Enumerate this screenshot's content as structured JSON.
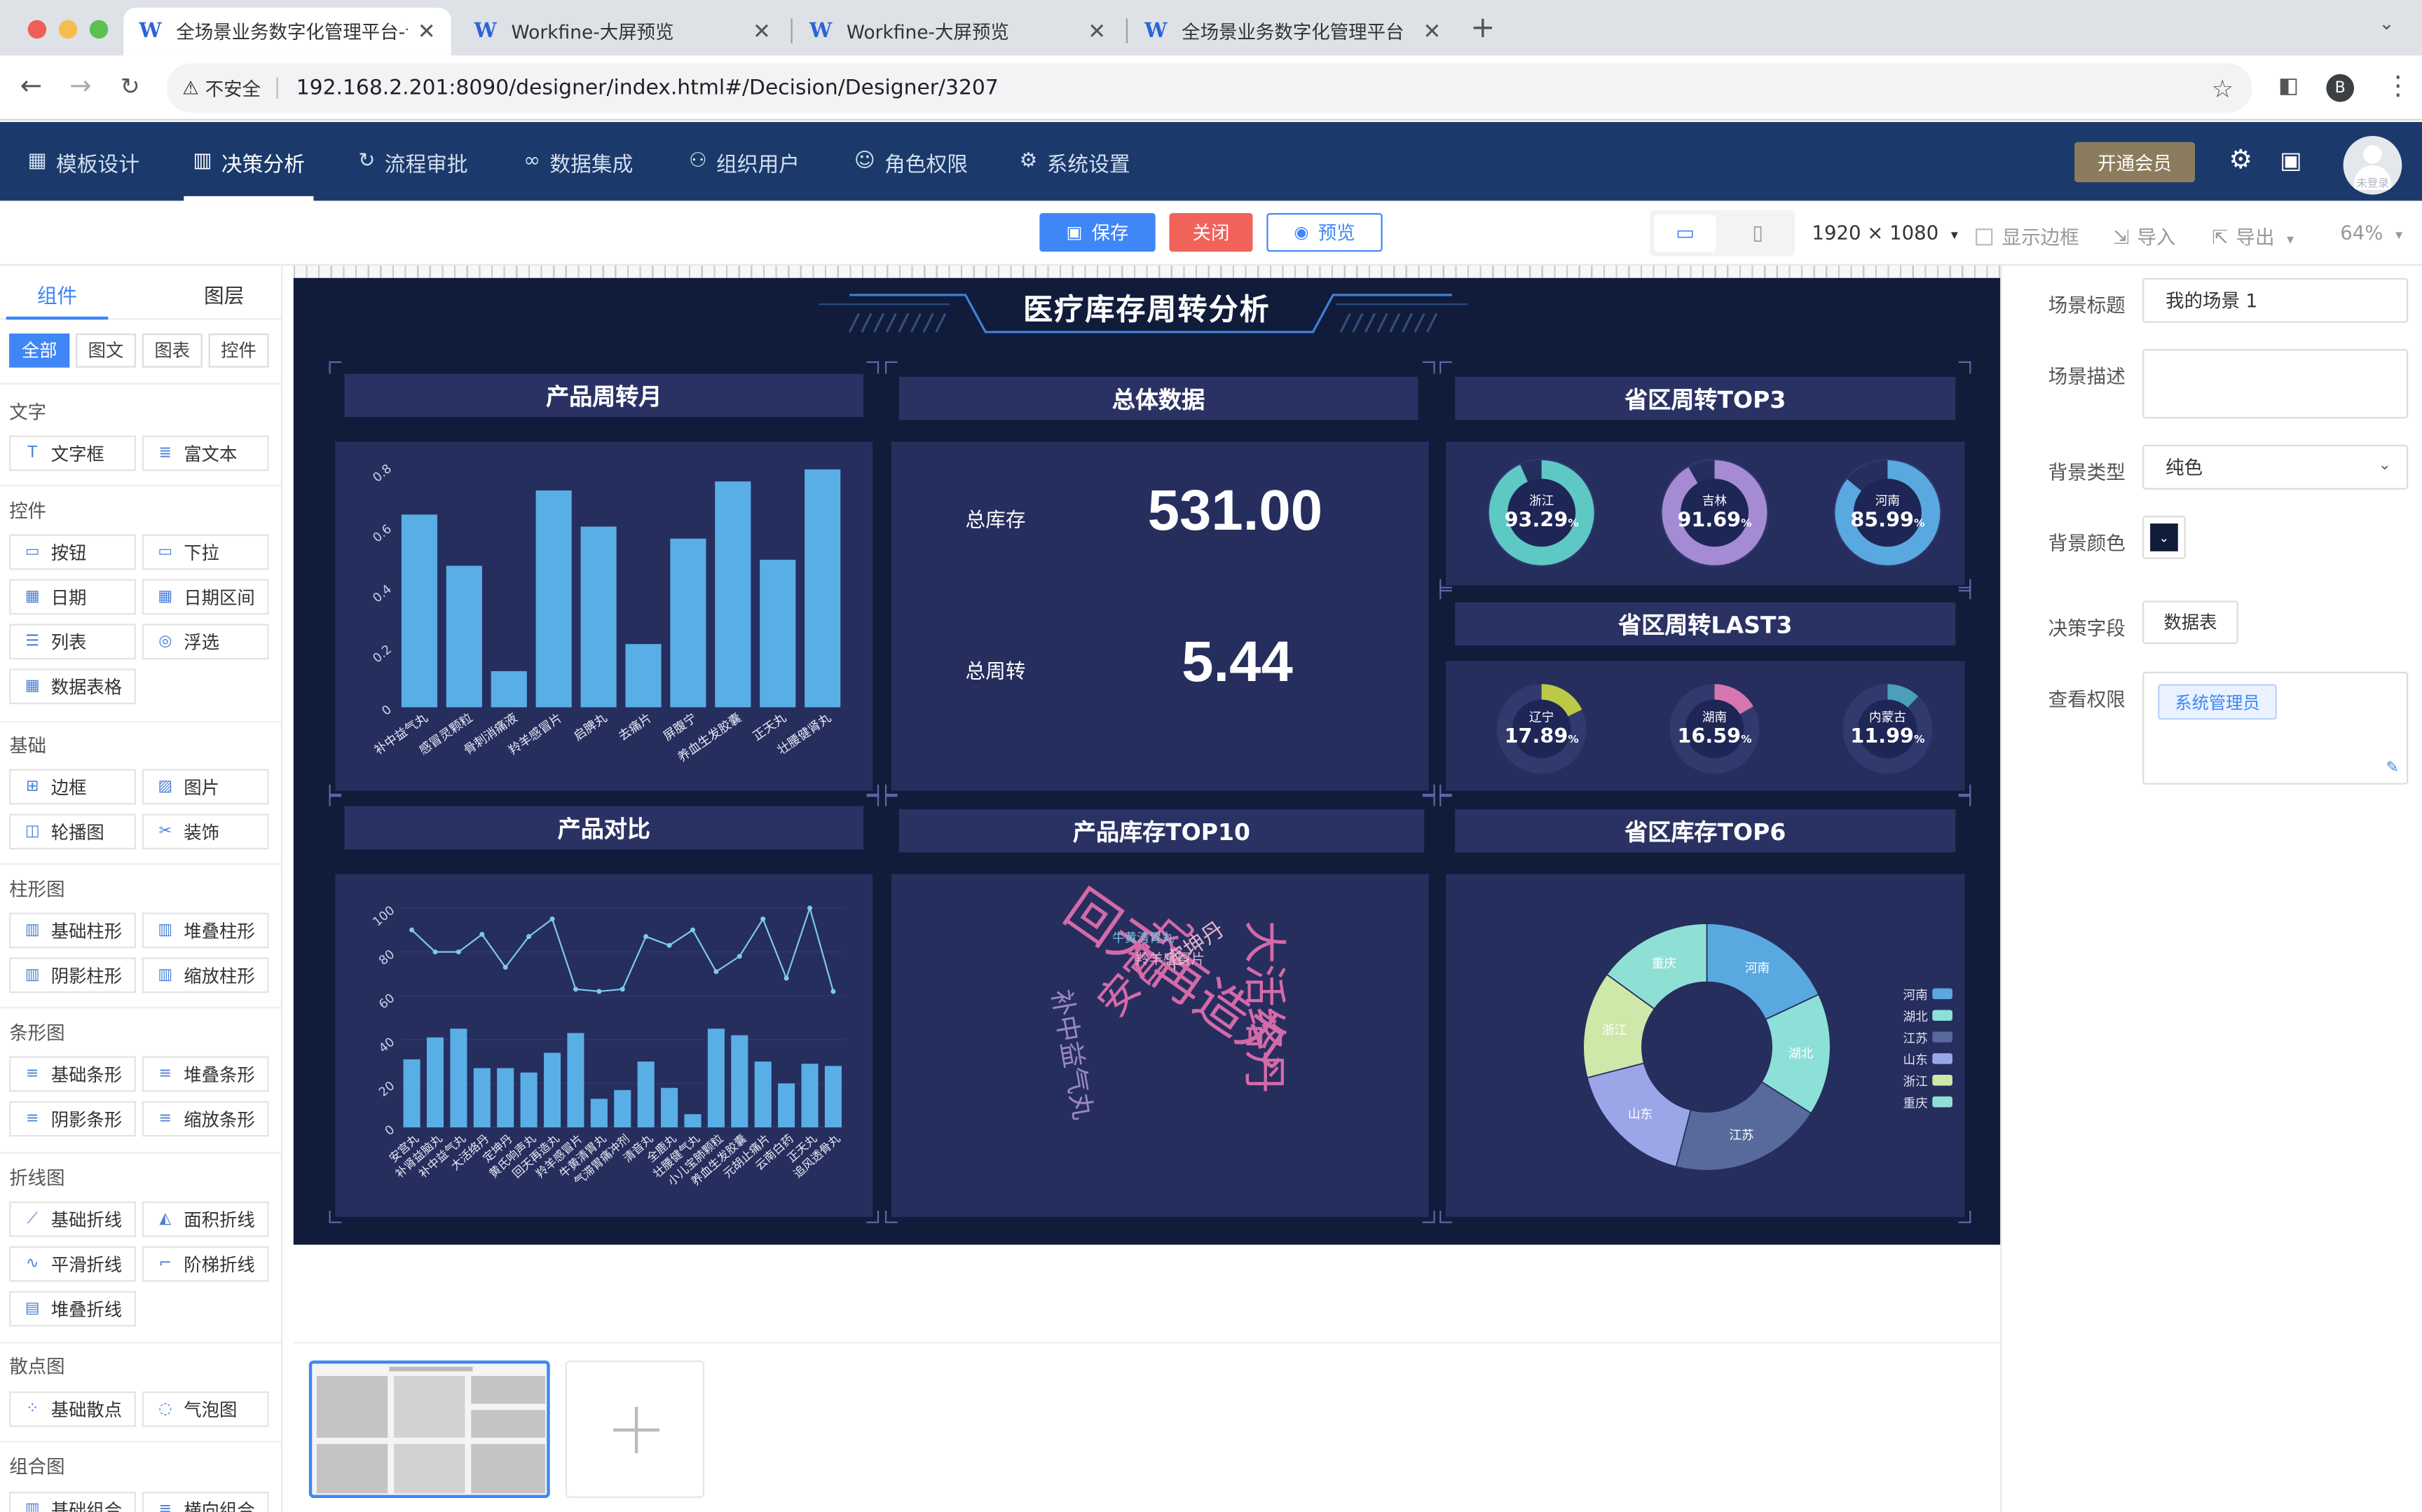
{
  "browser": {
    "tabs": [
      {
        "title": "全场景业务数字化管理平台-设计",
        "active": true
      },
      {
        "title": "Workfine-大屏预览",
        "active": false
      },
      {
        "title": "Workfine-大屏预览",
        "active": false
      },
      {
        "title": "全场景业务数字化管理平台",
        "active": false
      }
    ],
    "security": "不安全",
    "url": "192.168.2.201:8090/designer/index.html#/Decision/Designer/3207",
    "profile": "B"
  },
  "appnav": {
    "items": [
      "模板设计",
      "决策分析",
      "流程审批",
      "数据集成",
      "组织用户",
      "角色权限",
      "系统设置"
    ],
    "vip": "开通会员",
    "avatar_label": "未登录"
  },
  "toolbar": {
    "save": "保存",
    "close": "关闭",
    "preview": "预览",
    "resolution": "1920 × 1080",
    "show_border": "显示边框",
    "import": "导入",
    "export": "导出",
    "zoom": "64%"
  },
  "left": {
    "tabs": [
      "组件",
      "图层"
    ],
    "filters": [
      "全部",
      "图文",
      "图表",
      "控件"
    ],
    "cat_text": "文字",
    "text_items": [
      "文字框",
      "富文本"
    ],
    "cat_control": "控件",
    "control_items": [
      "按钮",
      "下拉",
      "日期",
      "日期区间",
      "列表",
      "浮选",
      "数据表格"
    ],
    "cat_basic": "基础",
    "basic_items": [
      "边框",
      "图片",
      "轮播图",
      "装饰"
    ],
    "cat_column": "柱形图",
    "column_items": [
      "基础柱形",
      "堆叠柱形",
      "阴影柱形",
      "缩放柱形"
    ],
    "cat_bar": "条形图",
    "bar_items": [
      "基础条形",
      "堆叠条形",
      "阴影条形",
      "缩放条形"
    ],
    "cat_line": "折线图",
    "line_items": [
      "基础折线",
      "面积折线",
      "平滑折线",
      "阶梯折线",
      "堆叠折线"
    ],
    "cat_scatter": "散点图",
    "scatter_items": [
      "基础散点",
      "气泡图"
    ],
    "cat_combo": "组合图",
    "combo_items": [
      "基础组合",
      "横向组合"
    ]
  },
  "screen": {
    "title": "医疗库存周转分析",
    "bg_color": "#101c3a",
    "panels": {
      "turnover": "产品周转月",
      "overall": "总体数据",
      "prov_top3": "省区周转TOP3",
      "prov_last3": "省区周转LAST3",
      "compare": "产品对比",
      "stock_top10": "产品库存TOP10",
      "prov_stock_top6": "省区库存TOP6"
    },
    "kpis": [
      {
        "label": "总库存",
        "value": "531.00"
      },
      {
        "label": "总周转",
        "value": "5.44"
      }
    ],
    "top3": [
      {
        "name": "浙江",
        "value": "93.29",
        "pct": 0.9329,
        "color": "#5ec8c4"
      },
      {
        "name": "吉林",
        "value": "91.69",
        "pct": 0.9169,
        "color": "#a58bd4"
      },
      {
        "name": "河南",
        "value": "85.99",
        "pct": 0.8599,
        "color": "#5aa8e0"
      }
    ],
    "last3": [
      {
        "name": "辽宁",
        "value": "17.89",
        "pct": 0.1789,
        "color": "#bcc946"
      },
      {
        "name": "湖南",
        "value": "16.59",
        "pct": 0.1659,
        "color": "#d676b0"
      },
      {
        "name": "内蒙古",
        "value": "11.99",
        "pct": 0.1199,
        "color": "#4aa0b8"
      }
    ],
    "pct_sign": "%",
    "wordcloud": [
      {
        "text": "回天再造丸",
        "color": "#d46aa8"
      },
      {
        "text": "大活络丹",
        "color": "#d46aa8"
      },
      {
        "text": "安宫丸",
        "color": "#d46aa8"
      },
      {
        "text": "补中益气丸",
        "color": "#9a88c0"
      },
      {
        "text": "定坤丹",
        "color": "#e2b0cc"
      },
      {
        "text": "羚羊感冒片",
        "color": "#e2b0cc"
      },
      {
        "text": "牛黄清胃丸",
        "color": "#7cc0e0"
      }
    ]
  },
  "chart_data": [
    {
      "type": "bar",
      "title": "产品周转月",
      "categories": [
        "补中益气丸",
        "感冒灵颗粒",
        "骨刺消痛液",
        "羚羊感冒片",
        "启脾丸",
        "去痛片",
        "屏腹宁",
        "养血生发胶囊",
        "正天丸",
        "壮腰健肾丸"
      ],
      "values": [
        0.64,
        0.47,
        0.12,
        0.72,
        0.6,
        0.21,
        0.56,
        0.75,
        0.49,
        0.79
      ],
      "ylim": [
        0,
        0.8
      ],
      "yticks": [
        "0",
        "0.2",
        "0.4",
        "0.6",
        "0.8"
      ],
      "color": "#5aaee6"
    },
    {
      "type": "bar+line",
      "title": "产品对比",
      "categories": [
        "安宫丸",
        "补肾益脑丸",
        "补中益气丸",
        "大活络丹",
        "定坤丹",
        "黄氏响声丸",
        "回天再造丸",
        "羚羊感冒片",
        "牛黄清胃丸",
        "气滞胃痛冲剂",
        "清音丸",
        "全鹿丸",
        "壮腰健气丸",
        "小儿宝肺颗粒",
        "养血生发胶囊",
        "元胡止痛片",
        "云南白药",
        "正天丸",
        "追风透骨丸"
      ],
      "bar_values": [
        31,
        41,
        45,
        27,
        27,
        25,
        34,
        43,
        13,
        17,
        30,
        18,
        6,
        45,
        42,
        30,
        20,
        29,
        28
      ],
      "line_values": [
        90,
        80,
        80,
        88,
        73,
        87,
        95,
        63,
        62,
        63,
        87,
        83,
        90,
        71,
        78,
        95,
        68,
        100,
        62
      ],
      "ylim": [
        0,
        100
      ],
      "yticks": [
        "0",
        "20",
        "40",
        "60",
        "80",
        "100"
      ],
      "bar_color": "#5aaee6",
      "line_color": "#7ec8ef"
    },
    {
      "type": "pie",
      "title": "省区库存TOP6",
      "slices": [
        {
          "name": "河南",
          "value": 18,
          "color": "#5aa8e0"
        },
        {
          "name": "湖北",
          "value": 16,
          "color": "#8de0d8"
        },
        {
          "name": "江苏",
          "value": 20,
          "color": "#586a9c"
        },
        {
          "name": "山东",
          "value": 17,
          "color": "#9ba6e8"
        },
        {
          "name": "浙江",
          "value": 14,
          "color": "#cde8a8"
        },
        {
          "name": "重庆",
          "value": 15,
          "color": "#8fe0d4"
        }
      ]
    }
  ],
  "right": {
    "scene_title_label": "场景标题",
    "scene_title": "我的场景 1",
    "scene_desc_label": "场景描述",
    "bg_type_label": "背景类型",
    "bg_type": "纯色",
    "bg_color_label": "背景颜色",
    "field_label": "决策字段",
    "field_btn": "数据表",
    "perm_label": "查看权限",
    "perm_tag": "系统管理员"
  }
}
